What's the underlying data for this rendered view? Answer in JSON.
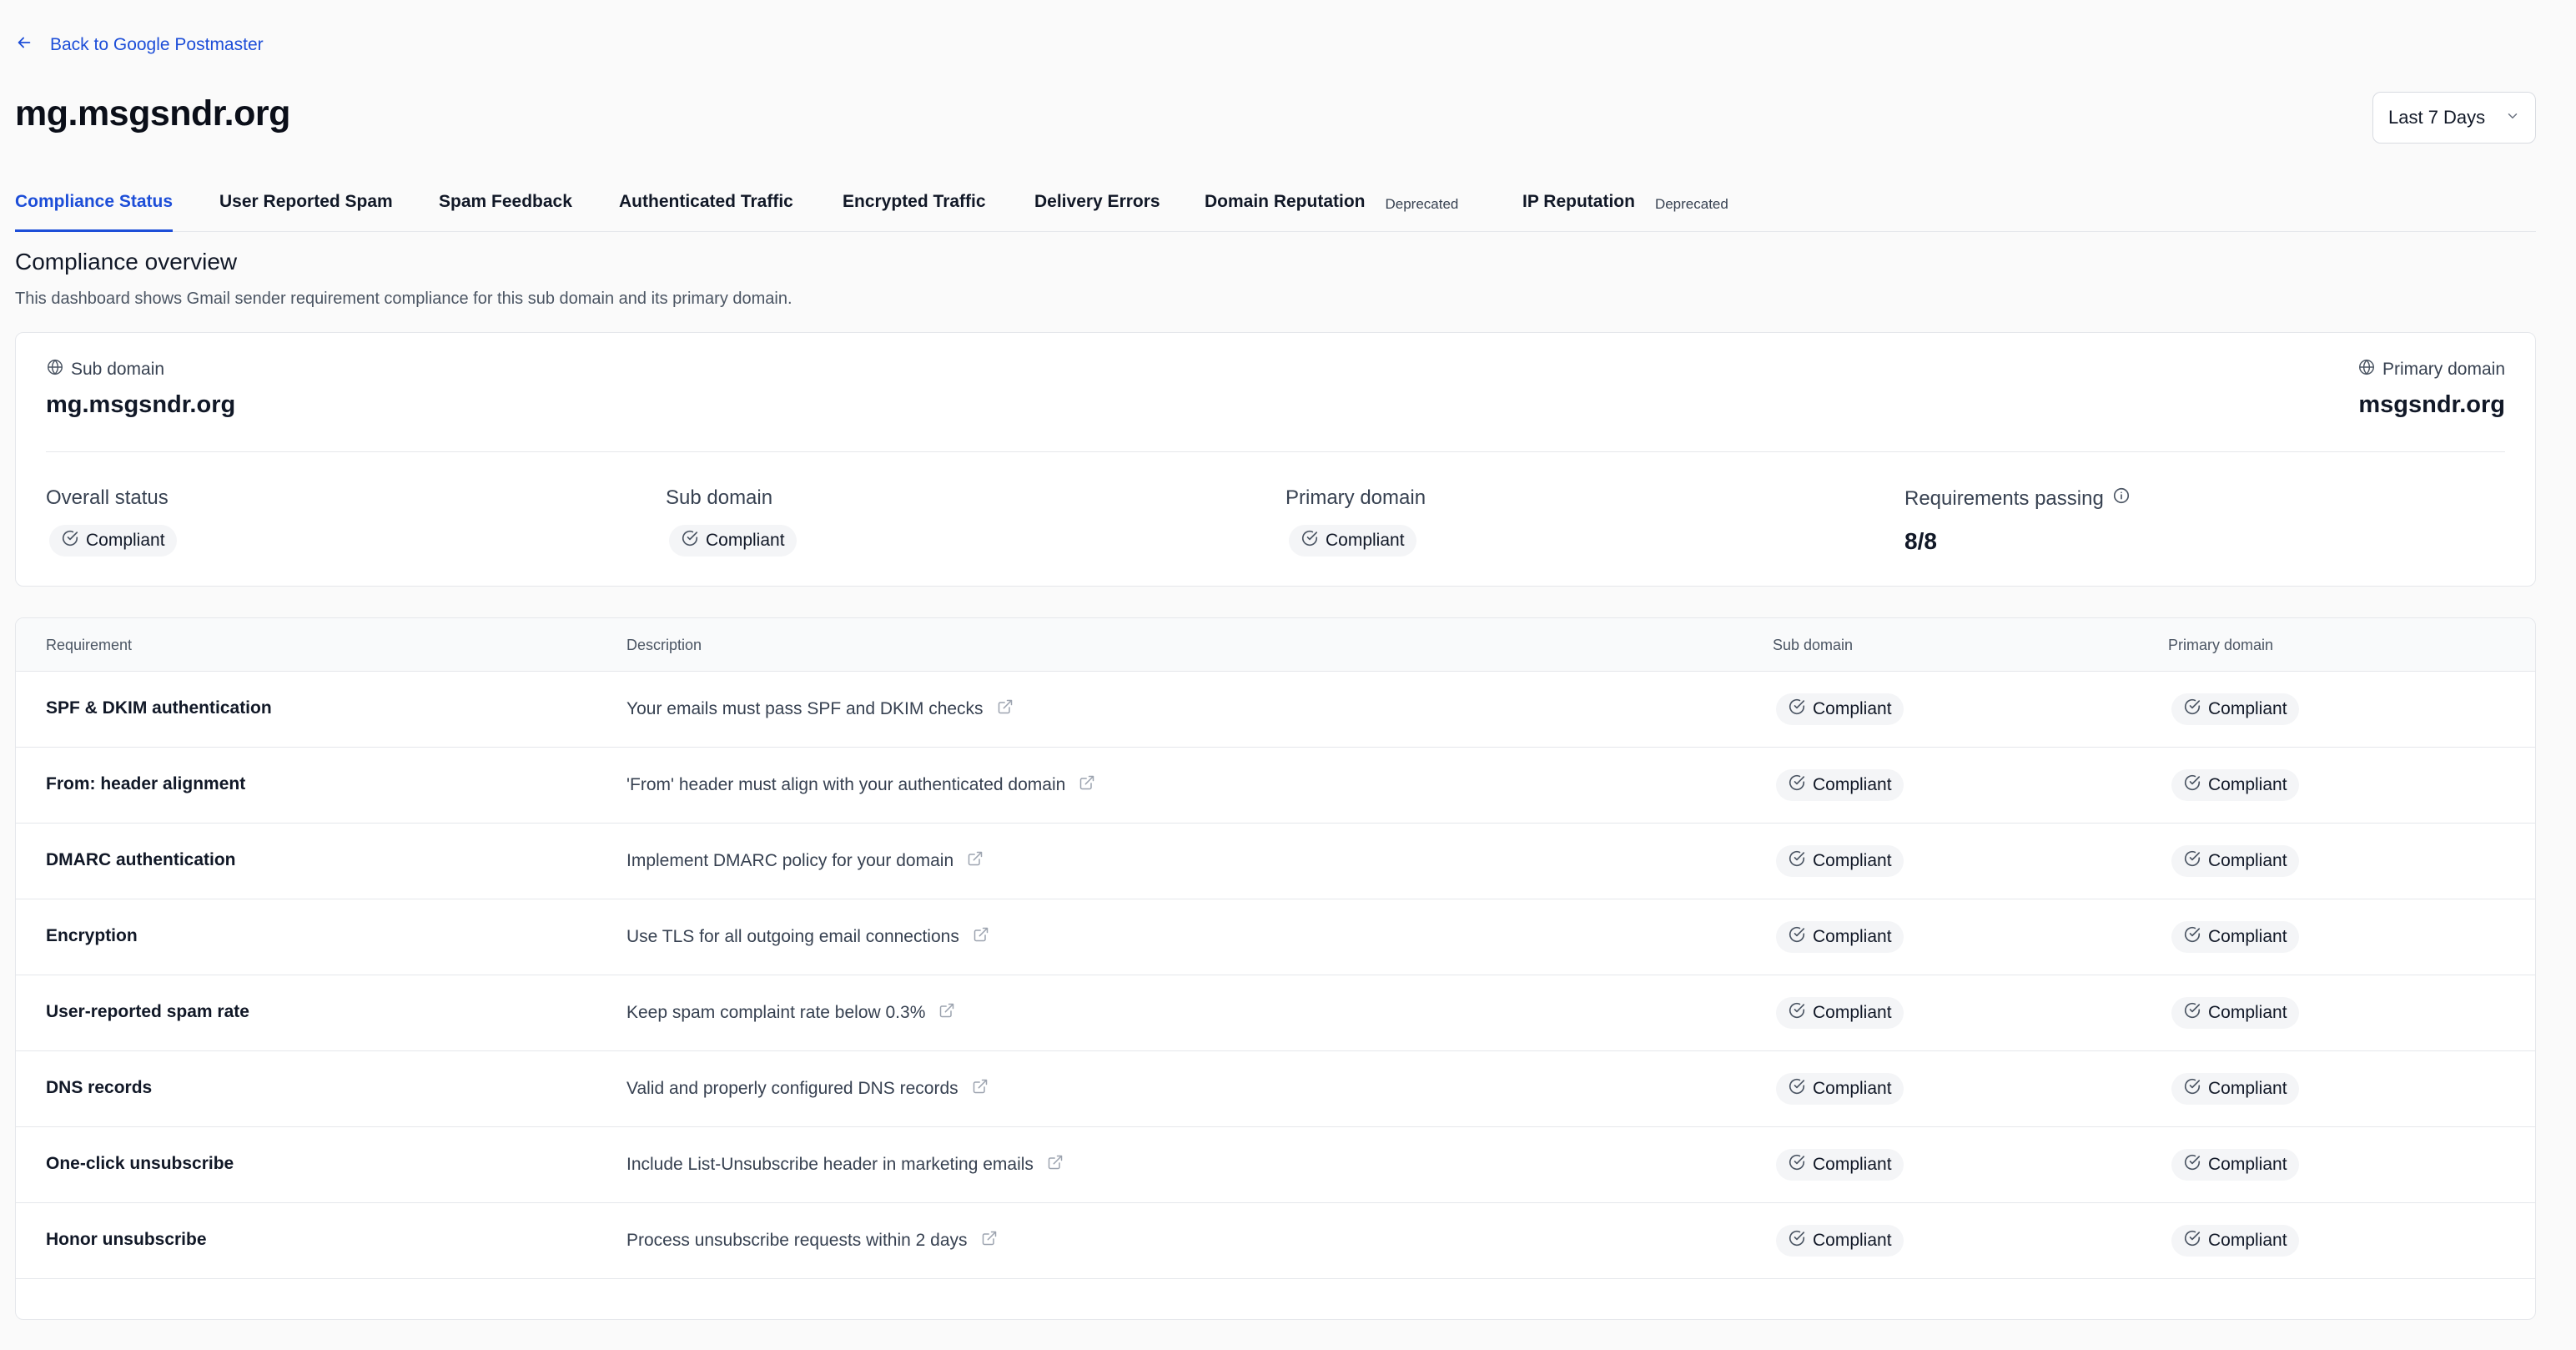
{
  "back_link": {
    "label": "Back to Google Postmaster",
    "icon": "arrow-left-icon"
  },
  "page_title": "mg.msgsndr.org",
  "date_range": {
    "value": "Last 7 Days",
    "icon": "chevron-down-icon"
  },
  "tabs": [
    {
      "label": "Compliance Status",
      "active": true,
      "badge": ""
    },
    {
      "label": "User Reported Spam",
      "active": false,
      "badge": ""
    },
    {
      "label": "Spam Feedback",
      "active": false,
      "badge": ""
    },
    {
      "label": "Authenticated Traffic",
      "active": false,
      "badge": ""
    },
    {
      "label": "Encrypted Traffic",
      "active": false,
      "badge": ""
    },
    {
      "label": "Delivery Errors",
      "active": false,
      "badge": ""
    },
    {
      "label": "Domain Reputation",
      "active": false,
      "badge": "Deprecated"
    },
    {
      "label": "IP Reputation",
      "active": false,
      "badge": "Deprecated"
    }
  ],
  "overview": {
    "title": "Compliance overview",
    "description": "This dashboard shows Gmail sender requirement compliance for this sub domain and its primary domain."
  },
  "summary": {
    "sub_domain_label": "Sub domain",
    "sub_domain_value": "mg.msgsndr.org",
    "primary_domain_label": "Primary domain",
    "primary_domain_value": "msgsndr.org",
    "overall_status_label": "Overall status",
    "overall_status_value": "Compliant",
    "sub_status_label": "Sub domain",
    "sub_status_value": "Compliant",
    "primary_status_label": "Primary domain",
    "primary_status_value": "Compliant",
    "requirements_label": "Requirements passing",
    "requirements_value": "8/8"
  },
  "table": {
    "headers": [
      "Requirement",
      "Description",
      "Sub domain",
      "Primary domain"
    ],
    "rows": [
      {
        "requirement": "SPF & DKIM authentication",
        "description": "Your emails must pass SPF and DKIM checks",
        "sub": "Compliant",
        "primary": "Compliant"
      },
      {
        "requirement": "From: header alignment",
        "description": "'From' header must align with your authenticated domain",
        "sub": "Compliant",
        "primary": "Compliant"
      },
      {
        "requirement": "DMARC authentication",
        "description": "Implement DMARC policy for your domain",
        "sub": "Compliant",
        "primary": "Compliant"
      },
      {
        "requirement": "Encryption",
        "description": "Use TLS for all outgoing email connections",
        "sub": "Compliant",
        "primary": "Compliant"
      },
      {
        "requirement": "User-reported spam rate",
        "description": "Keep spam complaint rate below 0.3%",
        "sub": "Compliant",
        "primary": "Compliant"
      },
      {
        "requirement": "DNS records",
        "description": "Valid and properly configured DNS records",
        "sub": "Compliant",
        "primary": "Compliant"
      },
      {
        "requirement": "One-click unsubscribe",
        "description": "Include List-Unsubscribe header in marketing emails",
        "sub": "Compliant",
        "primary": "Compliant"
      },
      {
        "requirement": "Honor unsubscribe",
        "description": "Process unsubscribe requests within 2 days",
        "sub": "Compliant",
        "primary": "Compliant"
      }
    ]
  },
  "colors": {
    "accent": "#1d4ed8",
    "text": "#111827",
    "muted": "#4b5563",
    "border": "#e5e7eb",
    "badge_bg": "#f4f5f7"
  }
}
